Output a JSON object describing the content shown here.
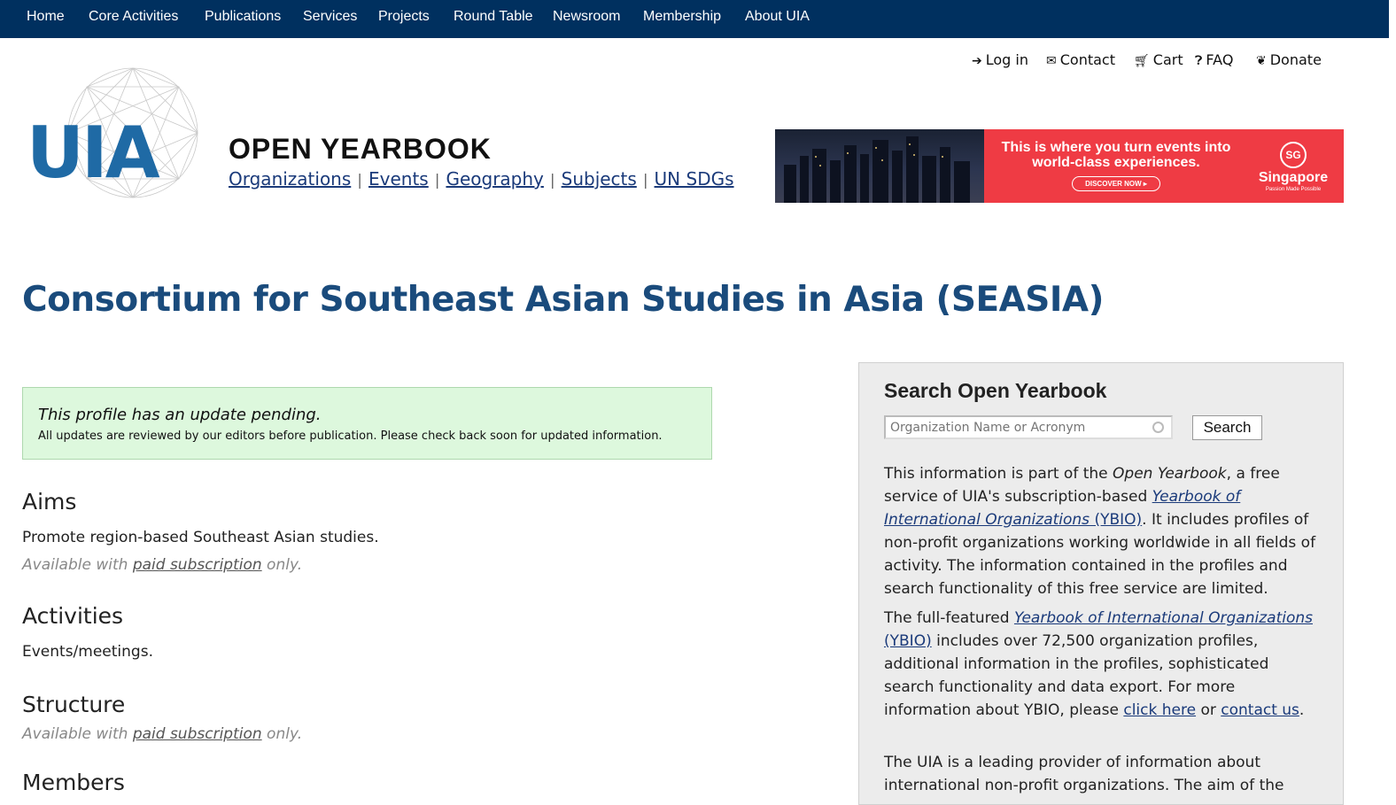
{
  "nav": {
    "items": [
      "Home",
      "Core Activities",
      "Publications",
      "Services",
      "Projects",
      "Round Table",
      "Newsroom",
      "Membership",
      "About UIA"
    ]
  },
  "utility": {
    "login": "Log in",
    "contact": "Contact",
    "cart": "Cart",
    "faq": "FAQ",
    "donate": "Donate"
  },
  "logo": {
    "text": "UIA"
  },
  "open_yearbook": {
    "title": "OPEN YEARBOOK",
    "links": [
      "Organizations",
      "Events",
      "Geography",
      "Subjects",
      "UN SDGs"
    ],
    "separator": "|"
  },
  "banner": {
    "tagline": "This is where you turn events into world-class experiences.",
    "cta": "DISCOVER NOW ▸",
    "brand_mark": "SG",
    "brand": "Singapore",
    "brand_sub": "Passion Made Possible"
  },
  "page": {
    "title": "Consortium for Southeast Asian Studies in Asia (SEASIA)"
  },
  "notice": {
    "heading": "This profile has an update pending.",
    "body": "All updates are reviewed by our editors before publication. Please check back soon for updated information."
  },
  "sections": {
    "aims": {
      "heading": "Aims",
      "text": "Promote region-based Southeast Asian studies.",
      "paid_prefix": "Available with ",
      "paid_link": "paid subscription",
      "paid_suffix": " only."
    },
    "activities": {
      "heading": "Activities",
      "text": "Events/meetings."
    },
    "structure": {
      "heading": "Structure",
      "paid_prefix": "Available with ",
      "paid_link": "paid subscription",
      "paid_suffix": " only."
    },
    "members": {
      "heading": "Members"
    }
  },
  "sidebar": {
    "heading": "Search Open Yearbook",
    "search_placeholder": "Organization Name or Acronym",
    "search_button": "Search",
    "para1": {
      "t1": "This information is part of the ",
      "em": "Open Yearbook",
      "t2": ", a free service of UIA's subscription-based ",
      "link_em": "Yearbook of International Organizations",
      "link_abbr": " (YBIO)",
      "t3": ". It includes profiles of non-profit organizations working worldwide in all fields of activity. The information contained in the profiles and search functionality of this free service are limited."
    },
    "para2": {
      "t1": "The full-featured ",
      "link_em": "Yearbook of International Organizations",
      "link_abbr": " (YBIO)",
      "t2": " includes over 72,500 organization profiles, additional information in the profiles, sophisticated search functionality and data export. For more information about YBIO, please ",
      "click_here": "click here",
      "t3": " or ",
      "contact_us": "contact us",
      "t4": "."
    },
    "para3": {
      "t1": "The UIA is a leading provider of information about international non-profit organizations. The aim of the"
    }
  },
  "colors": {
    "nav_bg": "#00305f",
    "logo_blue": "#1f6aa5",
    "title_blue": "#1a4b7c",
    "notice_bg": "#ddf8dd",
    "banner_red": "#ef3b44",
    "sidebar_bg": "#ececec"
  }
}
